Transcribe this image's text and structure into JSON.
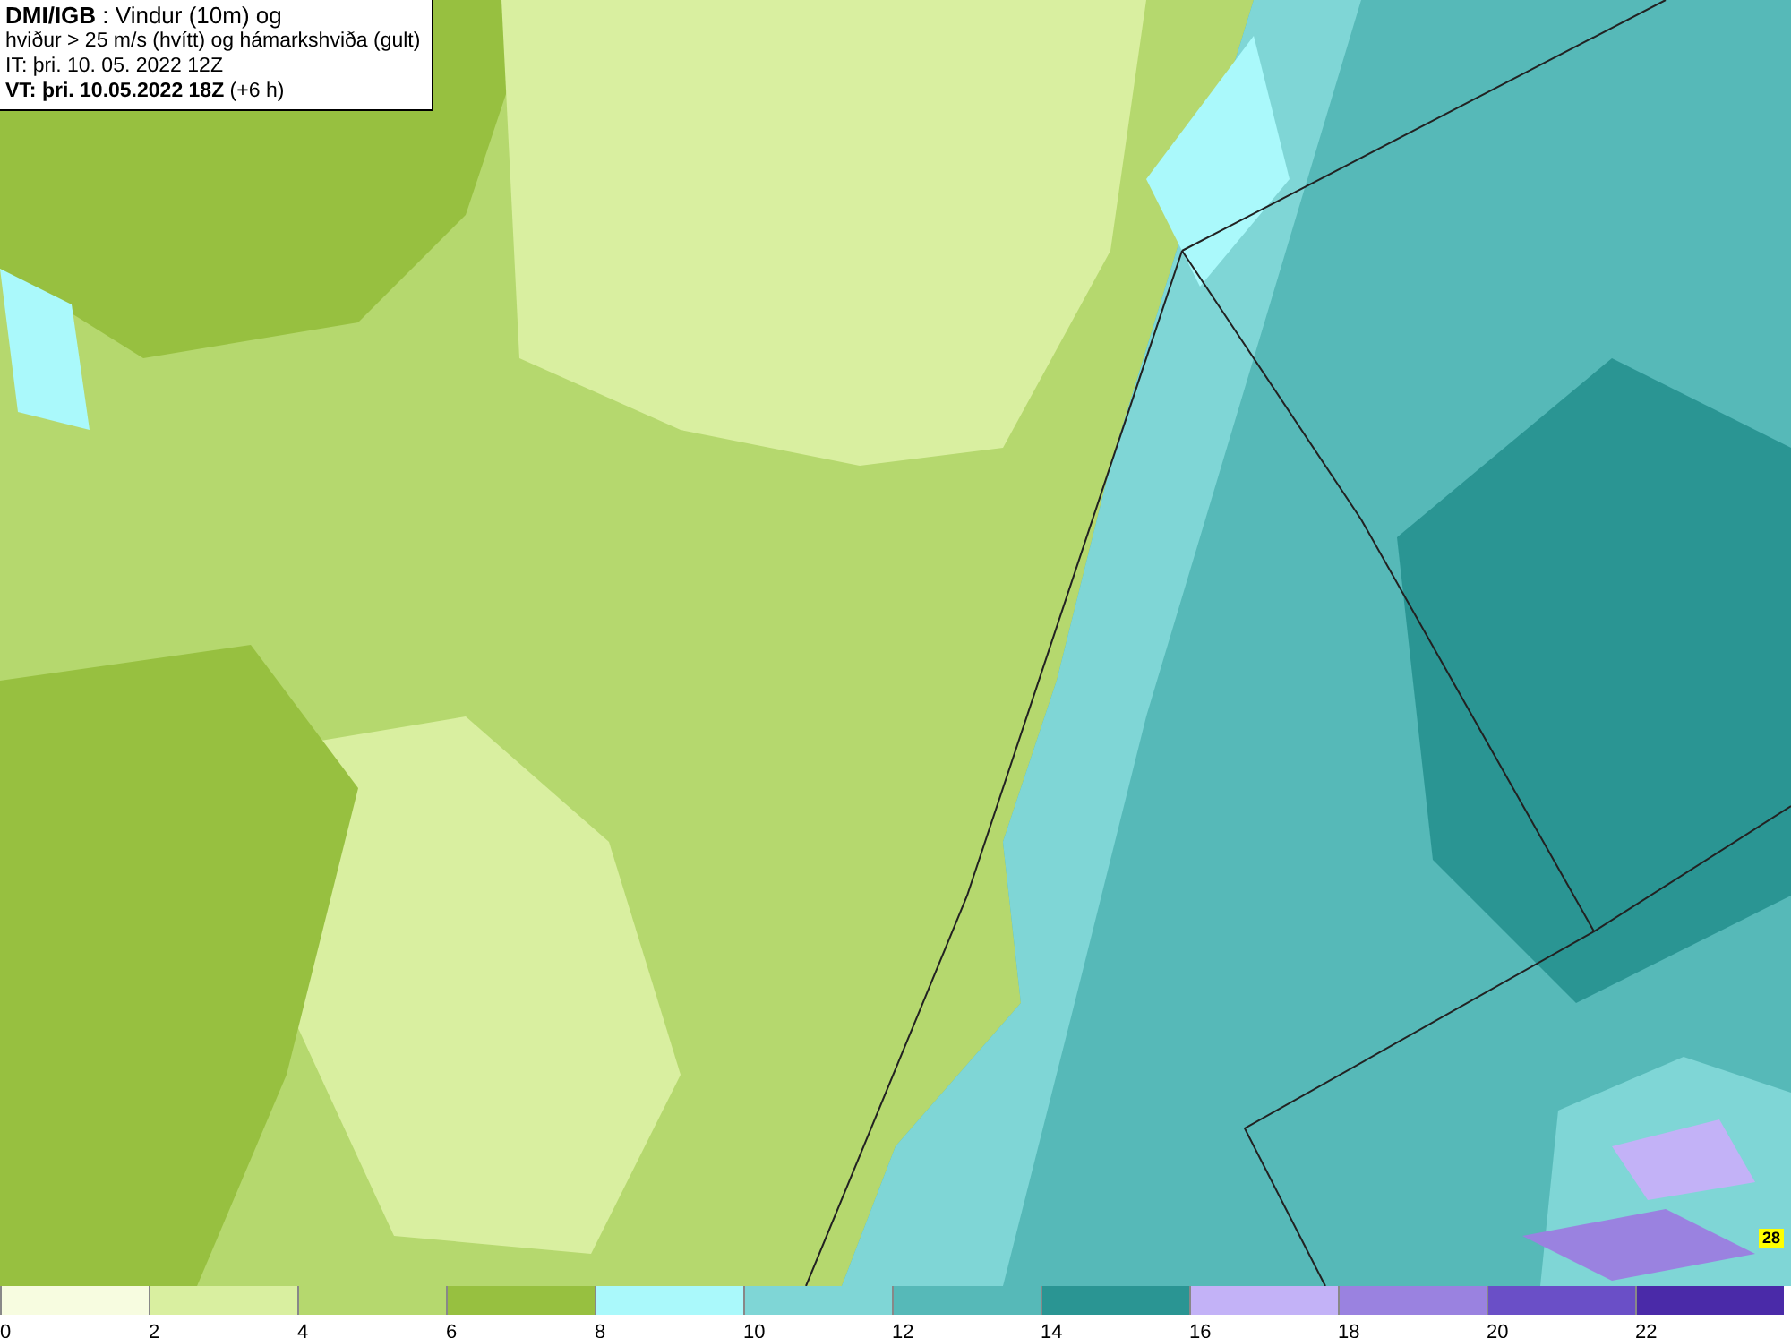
{
  "header": {
    "lines": [
      "**DMI/IGB** : Vindur (10m) og",
      "hviður > 25 m/s (hvítt) og hámarkshviða (gult)",
      "IT: þri. 10. 05. 2022 12Z",
      "**VT: þri. 10.05.2022 18Z** (+6 h)"
    ]
  },
  "map": {
    "gust_label": "28"
  },
  "legend": [
    {
      "label": "0",
      "color": "#f7fce0"
    },
    {
      "label": "2",
      "color": "#d9efa0"
    },
    {
      "label": "4",
      "color": "#b5d86e"
    },
    {
      "label": "6",
      "color": "#97c040"
    },
    {
      "label": "8",
      "color": "#aaf9fb"
    },
    {
      "label": "10",
      "color": "#7fd6d6"
    },
    {
      "label": "12",
      "color": "#56b9b8"
    },
    {
      "label": "14",
      "color": "#2a9593"
    },
    {
      "label": "16",
      "color": "#c3b2f7"
    },
    {
      "label": "18",
      "color": "#9a82e0"
    },
    {
      "label": "20",
      "color": "#6a4fc7"
    },
    {
      "label": "22",
      "color": "#4a2aa8"
    }
  ]
}
